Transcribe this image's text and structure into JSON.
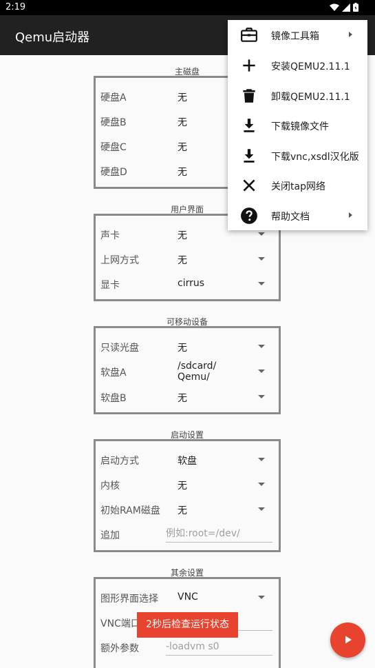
{
  "status_bar": {
    "time": "2:19"
  },
  "app": {
    "title": "Qemu启动器"
  },
  "sections": {
    "main_disk": {
      "label": "主磁盘",
      "rows": [
        {
          "label": "硬盘A",
          "value": "无"
        },
        {
          "label": "硬盘B",
          "value": "无"
        },
        {
          "label": "硬盘C",
          "value": "无"
        },
        {
          "label": "硬盘D",
          "value": "无"
        }
      ]
    },
    "ui": {
      "label": "用户界面",
      "rows": [
        {
          "label": "声卡",
          "value": "无"
        },
        {
          "label": "上网方式",
          "value": "无"
        },
        {
          "label": "显卡",
          "value": "cirrus"
        }
      ]
    },
    "removable": {
      "label": "可移动设备",
      "rows": [
        {
          "label": "只读光盘",
          "value": "无"
        },
        {
          "label": "软盘A",
          "value_line1": "/sdcard/",
          "value_line2": "Qemu/"
        },
        {
          "label": "软盘B",
          "value": "无"
        }
      ]
    },
    "boot": {
      "label": "启动设置",
      "rows": [
        {
          "label": "启动方式",
          "value": "软盘"
        },
        {
          "label": "内核",
          "value": "无"
        },
        {
          "label": "初始RAM磁盘",
          "value": "无"
        },
        {
          "label": "追加",
          "placeholder": "例如:root=/dev/"
        }
      ]
    },
    "other": {
      "label": "其余设置",
      "rows": [
        {
          "label": "图形界面选择",
          "value": "VNC"
        },
        {
          "label": "VNC端口",
          "placeholder": ""
        },
        {
          "label": "额外参数",
          "placeholder": "-loadvm s0"
        }
      ]
    }
  },
  "menu": {
    "items": [
      {
        "label": "镜像工具箱",
        "icon": "toolbox-icon",
        "has_submenu": true
      },
      {
        "label": "安装QEMU2.11.1",
        "icon": "plus-icon"
      },
      {
        "label": "卸载QEMU2.11.1",
        "icon": "trash-icon"
      },
      {
        "label": "下载镜像文件",
        "icon": "download-icon"
      },
      {
        "label": "下载vnc,xsdl汉化版",
        "icon": "download-icon"
      },
      {
        "label": "关闭tap网络",
        "icon": "close-icon"
      },
      {
        "label": "帮助文档",
        "icon": "help-icon",
        "has_submenu": true
      }
    ]
  },
  "toast": {
    "text": "2秒后检查运行状态"
  },
  "fab": {
    "icon": "play-icon"
  },
  "colors": {
    "accent": "#e8432e",
    "appbar": "#212121"
  }
}
